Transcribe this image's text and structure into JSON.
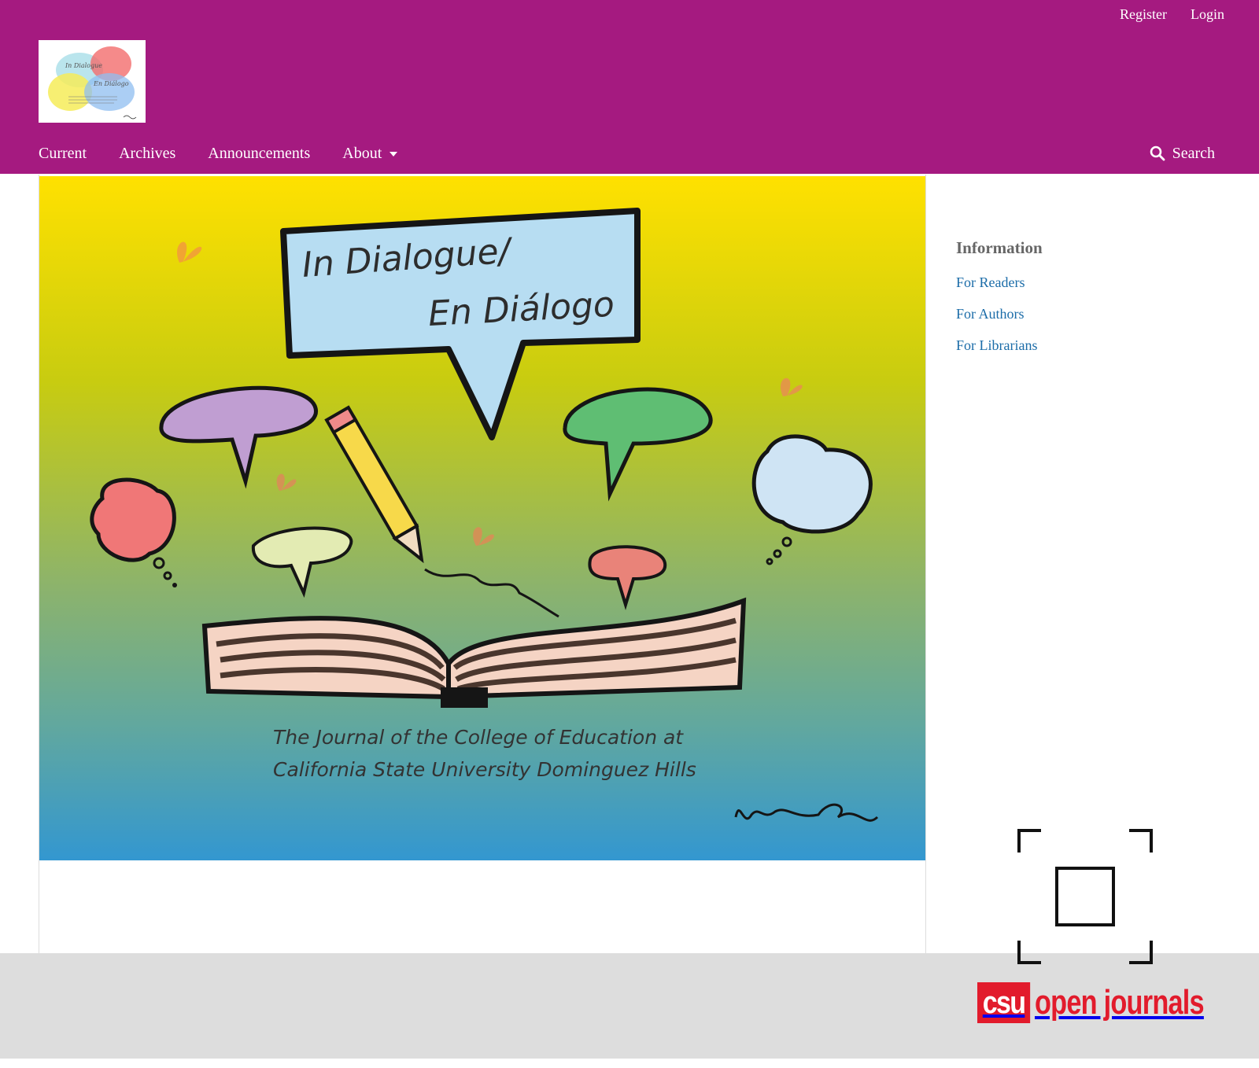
{
  "header": {
    "user_nav": {
      "register": "Register",
      "login": "Login"
    },
    "logo": {
      "alt": "In Dialogue / En Diálogo",
      "line1": "In Dialogue",
      "line2": "En Diálogo"
    },
    "nav": {
      "current": "Current",
      "archives": "Archives",
      "announcements": "Announcements",
      "about": "About",
      "search": "Search"
    }
  },
  "cover": {
    "title_line1": "In Dialogue/",
    "title_line2": "En Diálogo",
    "subtitle_line1": "The Journal of the College of Education at",
    "subtitle_line2": "California State University Dominguez Hills",
    "signature": "helenada"
  },
  "sidebar": {
    "heading": "Information",
    "links": [
      "For Readers",
      "For Authors",
      "For Librarians"
    ]
  },
  "footer": {
    "logo_csu": "csu",
    "logo_text": "open journals"
  },
  "colors": {
    "header_bg": "#a51a80",
    "link": "#1b6ca8",
    "footer_bg": "#dddddd",
    "brand_red": "#e21b2c"
  },
  "icons": {
    "search": "search-icon",
    "about_caret": "chevron-down-icon",
    "fullscreen": "fullscreen-icon"
  }
}
